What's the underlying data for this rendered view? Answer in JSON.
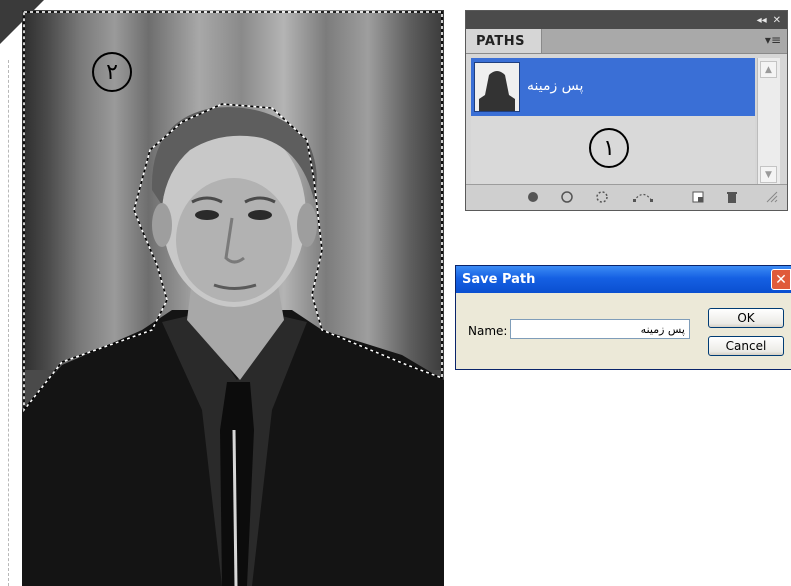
{
  "annotations": {
    "photo_badge": "٢",
    "panel_badge": "١"
  },
  "paths_panel": {
    "tab_label": "PATHS",
    "collapse_glyph": "◂◂",
    "close_glyph": "✕",
    "menu_glyph": "▾≡",
    "items": [
      {
        "name": "پس زمینه",
        "selected": true
      }
    ],
    "footer_icons": [
      "fill-path-icon",
      "stroke-path-icon",
      "load-as-selection-icon",
      "make-work-path-icon",
      "new-path-icon",
      "delete-path-icon"
    ]
  },
  "save_path_dialog": {
    "title": "Save Path",
    "close_glyph": "✕",
    "name_label": "Name:",
    "name_value": "پس زمینه",
    "ok_label": "OK",
    "cancel_label": "Cancel"
  },
  "colors": {
    "selection_blue": "#3a6fd6",
    "xp_title_blue": "#0a4fd0",
    "close_red": "#e05a3a",
    "panel_gray": "#d6d6d6"
  }
}
